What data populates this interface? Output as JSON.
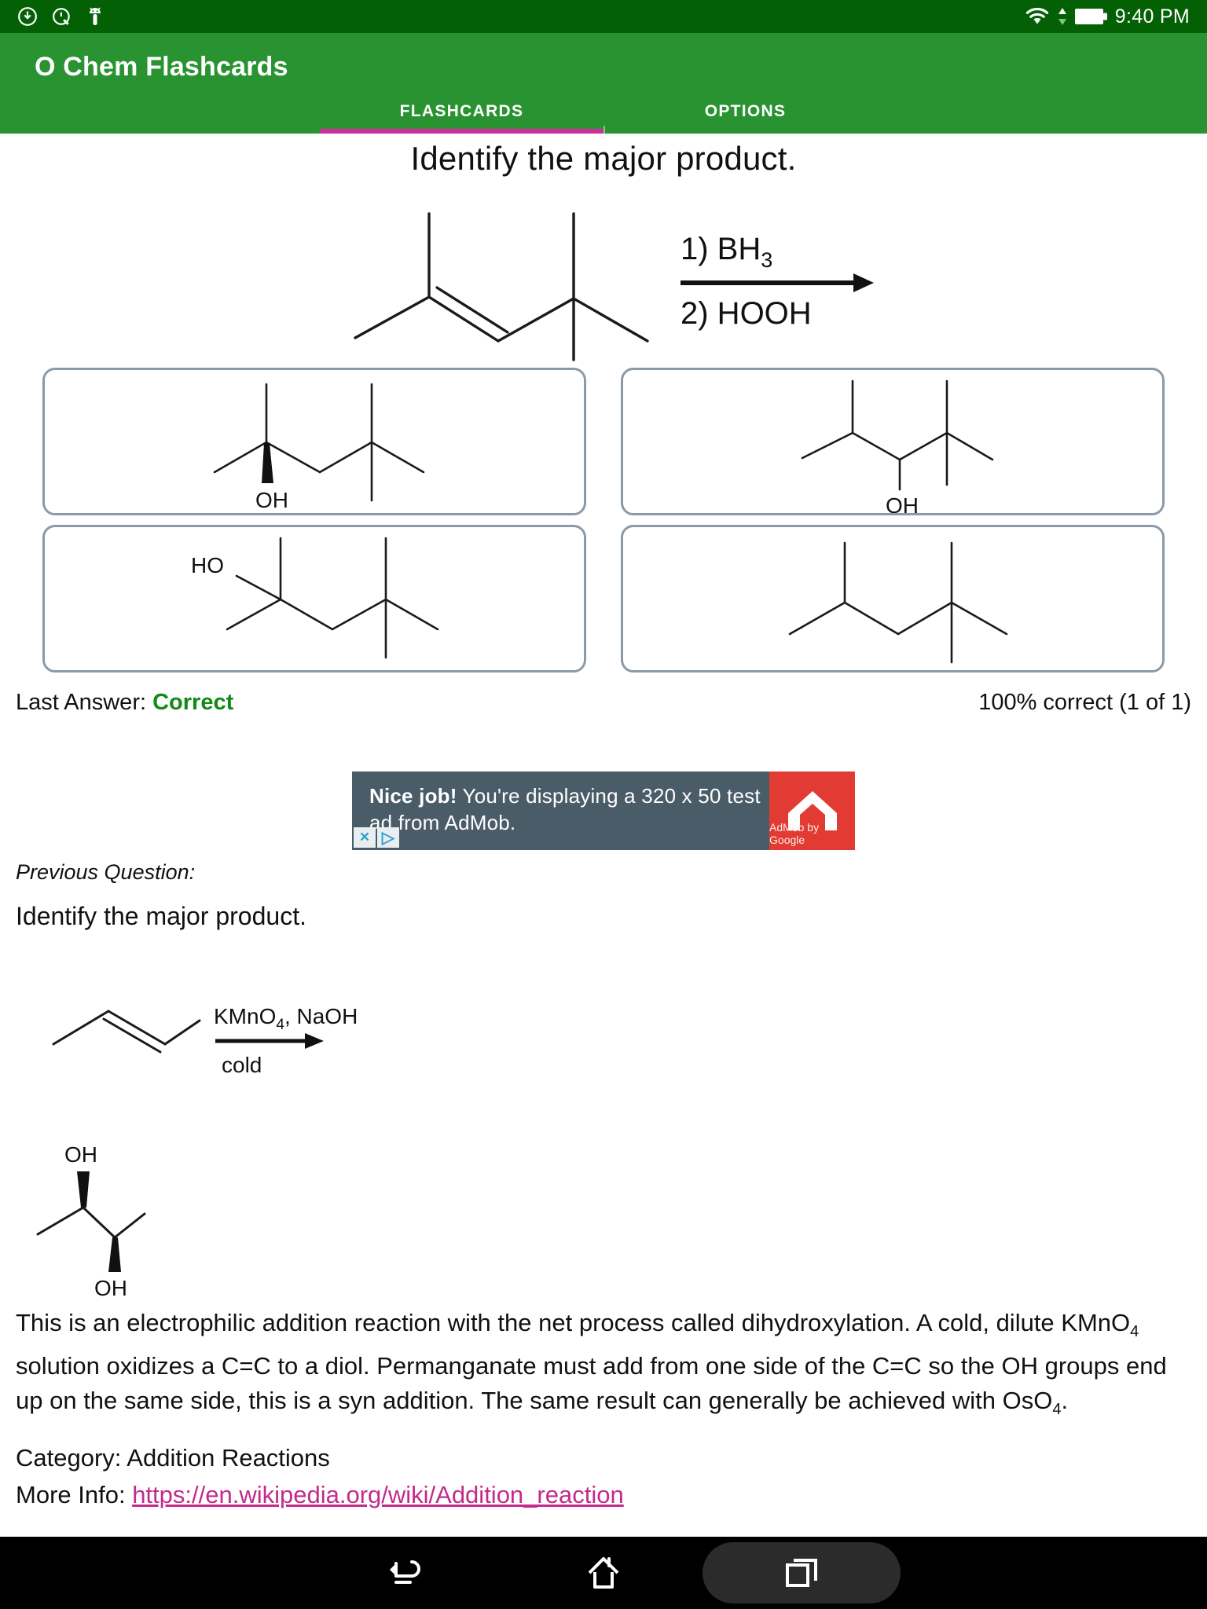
{
  "status_bar": {
    "icons": [
      "download-icon",
      "developer-options-icon",
      "android-debug-icon"
    ],
    "right_icons": [
      "wifi-icon",
      "data-transfer-icon",
      "battery-icon"
    ],
    "time": "9:40 PM"
  },
  "app_bar": {
    "title": "O Chem Flashcards",
    "accent_color": "#2a9331",
    "tab_indicator_color": "#cf2f9e",
    "tabs": [
      {
        "label": "FLASHCARDS",
        "active": true
      },
      {
        "label": "OPTIONS",
        "active": false
      }
    ]
  },
  "question": {
    "prompt": "Identify the major product.",
    "reagents": {
      "step1": "1) BH",
      "step1_sub": "3",
      "step2": "2) HOOH"
    }
  },
  "answer_options": [
    {
      "index": 1,
      "label": "OH",
      "description": "branched chain with wedge hydroxyl on left carbon"
    },
    {
      "index": 2,
      "label": "OH",
      "description": "branched chain with hydroxyl on central carbon"
    },
    {
      "index": 3,
      "label": "HO",
      "description": "tertiary alcohol, hydroxyl on left quaternary carbon"
    },
    {
      "index": 4,
      "label": "",
      "description": "alkane skeleton, no hydroxyl"
    }
  ],
  "status": {
    "last_answer_label": "Last Answer:",
    "last_answer_value": "Correct",
    "last_answer_color": "#128a16",
    "score": "100% correct (1 of 1)"
  },
  "ad": {
    "headline": "Nice job!",
    "body": " You're displaying a 320 x 50 test ad from AdMob.",
    "logo_caption": "AdMob by Google",
    "close_label": "×",
    "info_label": "▷",
    "bg_color": "#4a5c68",
    "logo_color": "#e23b33"
  },
  "previous": {
    "label": "Previous Question:",
    "prompt": "Identify the major product.",
    "reagents_top": "KMnO",
    "reagents_top_sub": "4",
    "reagents_top_rest": ", NaOH",
    "reagents_bottom": "cold",
    "product_labels": [
      "OH",
      "OH"
    ],
    "explanation_part1": "This is an electrophilic addition reaction with the net process called dihydroxylation. A cold, dilute KMnO",
    "explanation_sub1": "4",
    "explanation_part2": " solution oxidizes a C=C to a diol. Permanganate must add from one side of the C=C so the OH groups end up on the same side, this is a syn addition. The same result can generally be achieved with OsO",
    "explanation_sub2": "4",
    "explanation_part3": ".",
    "category_label": "Category: Addition Reactions",
    "more_info_label": "More Info: ",
    "more_info_url": "https://en.wikipedia.org/wiki/Addition_reaction"
  },
  "nav_bar": {
    "buttons": [
      "back-icon",
      "home-icon",
      "recents-icon"
    ]
  }
}
